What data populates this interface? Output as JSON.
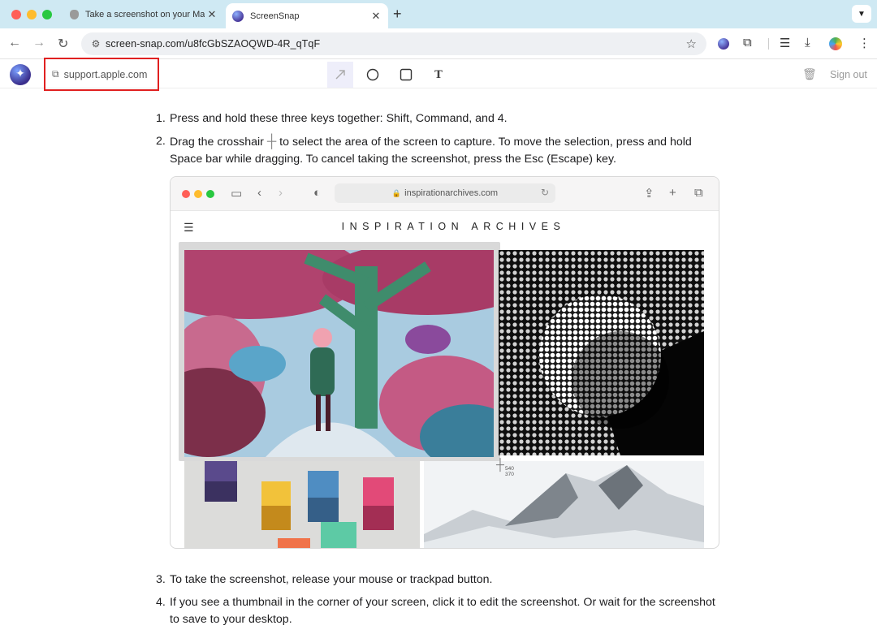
{
  "browser": {
    "tabs": [
      {
        "title": "Take a screenshot on your Mac",
        "active": false
      },
      {
        "title": "ScreenSnap",
        "active": true
      }
    ],
    "url": "screen-snap.com/u8fcGbSZAOQWD-4R_qTqF"
  },
  "app": {
    "source_link": "support.apple.com",
    "sign_out": "Sign out",
    "tools": [
      "arrow",
      "circle",
      "rectangle",
      "text"
    ],
    "text_tool_glyph": "T"
  },
  "content": {
    "steps": [
      {
        "num": "1.",
        "text": "Press and hold these three keys together: Shift, Command, and 4."
      },
      {
        "num": "2.",
        "text_before": "Drag the crosshair",
        "text_after": "to select the area of the screen to capture. To move the selection, press and hold Space bar while dragging. To cancel taking the screenshot, press the Esc (Escape) key."
      },
      {
        "num": "3.",
        "text": "To take the screenshot, release your mouse or trackpad button."
      },
      {
        "num": "4.",
        "text": "If you see a thumbnail in the corner of your screen, click it to edit the screenshot. Or wait for the screenshot to save to your desktop."
      }
    ]
  },
  "embedded_screenshot": {
    "address": "inspirationarchives.com",
    "site_title": "INSPIRATION ARCHIVES",
    "coord_x": "540",
    "coord_y": "370"
  },
  "colors": {
    "tabstrip": "#cfe9f3",
    "highlight_border": "#e02020",
    "traffic_red": "#ff5f57",
    "traffic_yellow": "#febc2e",
    "traffic_green": "#28c840"
  }
}
